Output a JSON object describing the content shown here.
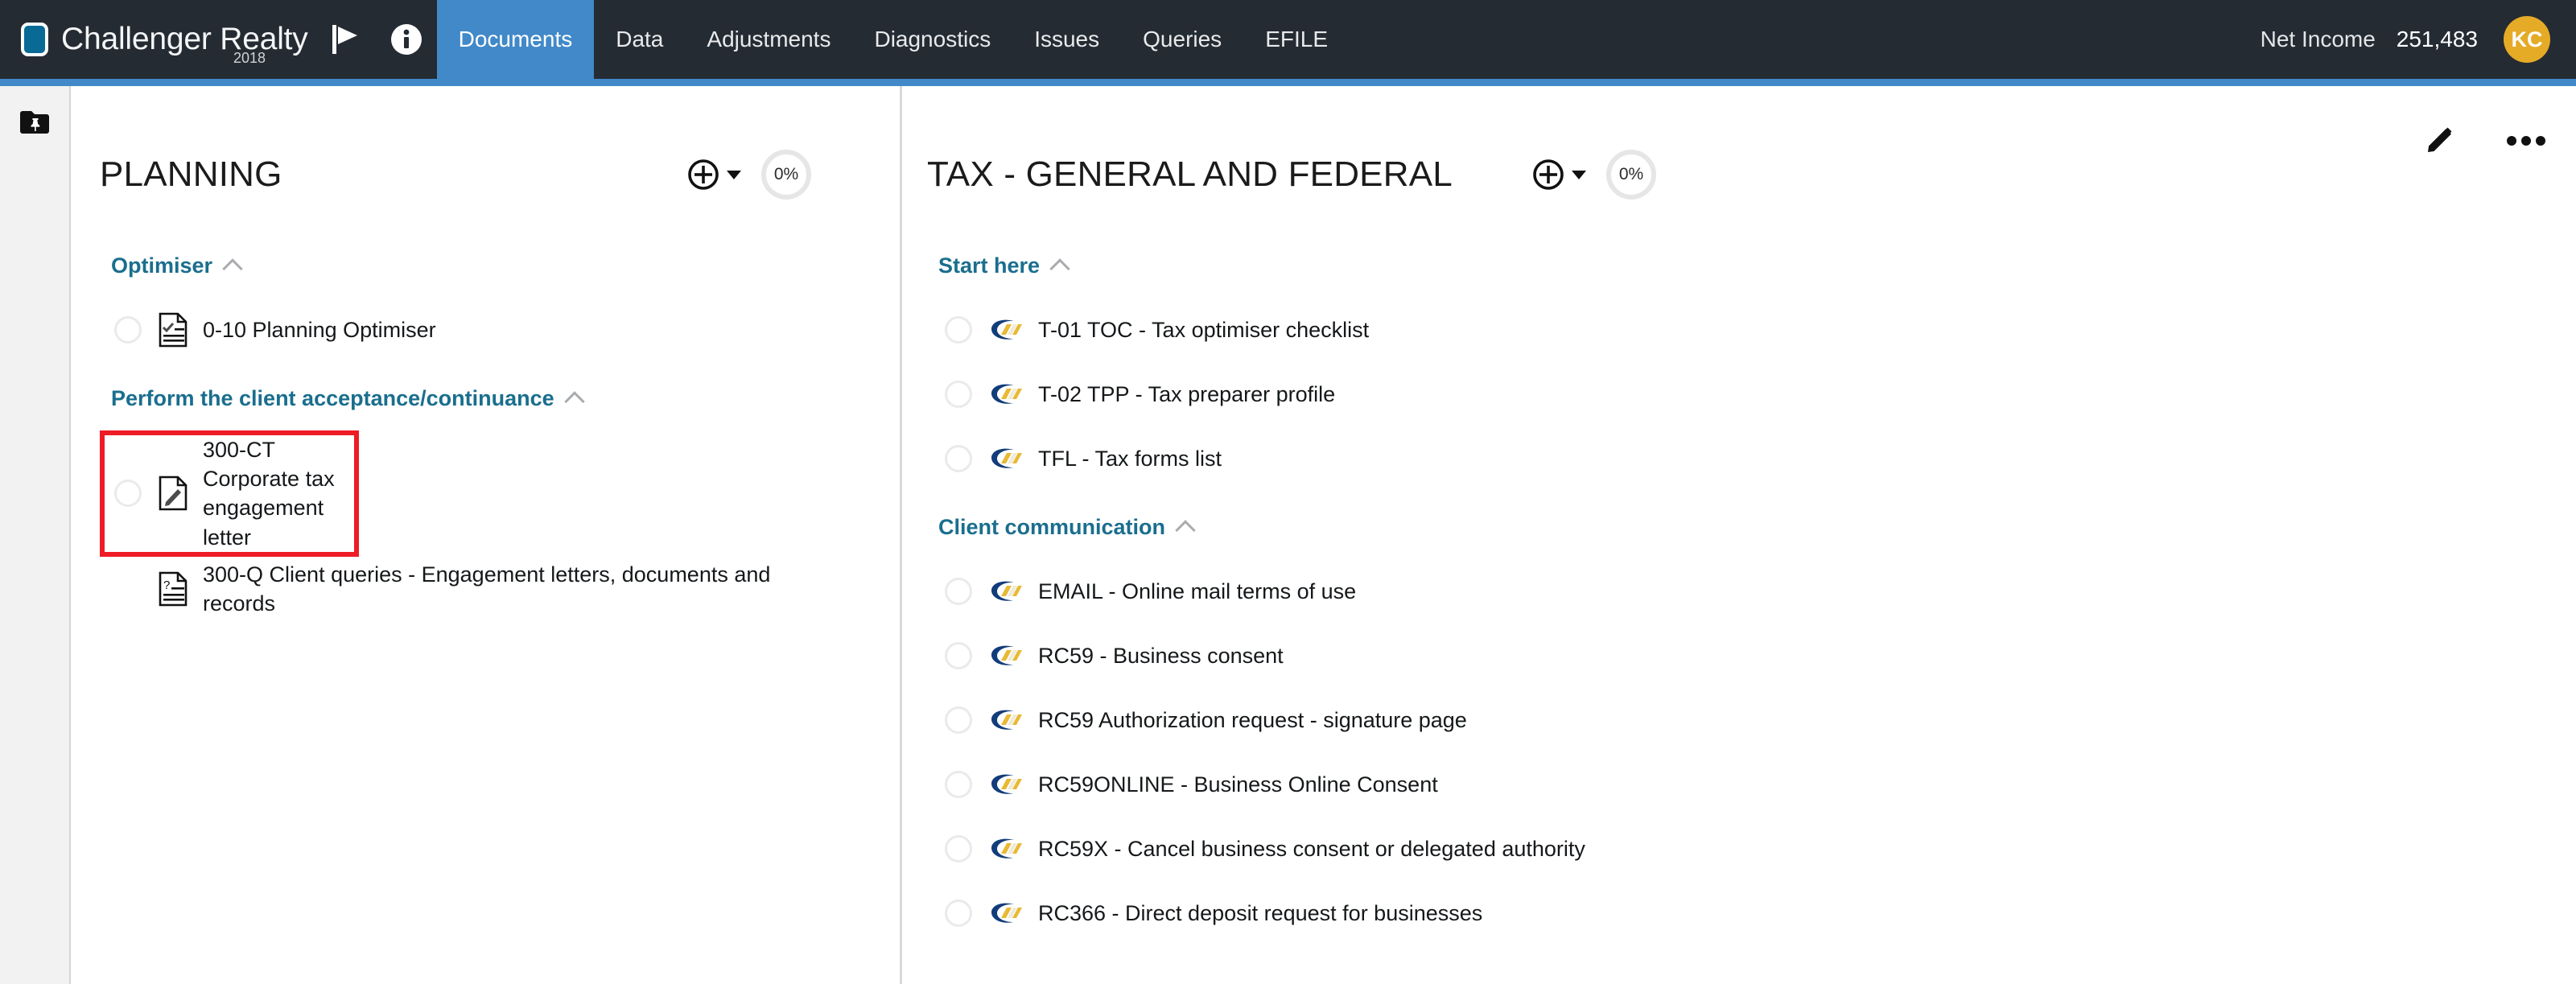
{
  "header": {
    "brand_name": "Challenger Realty",
    "brand_year": "2018",
    "flag_icon": "flag-icon",
    "info_icon": "info-icon",
    "tabs": [
      {
        "label": "Documents",
        "active": true
      },
      {
        "label": "Data",
        "active": false
      },
      {
        "label": "Adjustments",
        "active": false
      },
      {
        "label": "Diagnostics",
        "active": false
      },
      {
        "label": "Issues",
        "active": false
      },
      {
        "label": "Queries",
        "active": false
      },
      {
        "label": "EFILE",
        "active": false
      }
    ],
    "net_income_label": "Net Income",
    "net_income_value": "251,483",
    "avatar_initials": "KC",
    "accent_color": "#4189c8",
    "bar_color": "#252b33",
    "avatar_color": "#e5ab27"
  },
  "left_rail": {
    "pin_folder_icon": "folder-pin-icon"
  },
  "page_actions": {
    "edit_icon": "pencil-icon",
    "more_icon": "ellipsis-icon"
  },
  "columns": [
    {
      "title": "PLANNING",
      "add_label": "add-document",
      "progress": "0%",
      "groups": [
        {
          "title": "Optimiser",
          "items": [
            {
              "label": "0-10 Planning Optimiser",
              "icon": "document-checklist-icon",
              "has_checkbox": true,
              "highlighted": false
            }
          ]
        },
        {
          "title": "Perform the client acceptance/continuance",
          "items": [
            {
              "label": "300-CT Corporate tax engagement letter",
              "icon": "document-pencil-icon",
              "has_checkbox": true,
              "highlighted": true
            },
            {
              "label": "300-Q Client queries - Engagement letters, documents and records",
              "icon": "document-question-icon",
              "has_checkbox": false,
              "highlighted": false
            }
          ]
        }
      ]
    },
    {
      "title": "TAX - GENERAL AND FEDERAL",
      "add_label": "add-document",
      "progress": "0%",
      "groups": [
        {
          "title": "Start here",
          "items": [
            {
              "label": "T-01 TOC - Tax optimiser checklist",
              "icon": "tax-form-icon",
              "has_checkbox": true,
              "highlighted": false
            },
            {
              "label": "T-02 TPP - Tax preparer profile",
              "icon": "tax-form-icon",
              "has_checkbox": true,
              "highlighted": false
            },
            {
              "label": "TFL - Tax forms list",
              "icon": "tax-form-icon",
              "has_checkbox": true,
              "highlighted": false
            }
          ]
        },
        {
          "title": "Client communication",
          "items": [
            {
              "label": "EMAIL - Online mail terms of use",
              "icon": "tax-form-icon",
              "has_checkbox": true,
              "highlighted": false
            },
            {
              "label": "RC59 - Business consent",
              "icon": "tax-form-icon",
              "has_checkbox": true,
              "highlighted": false
            },
            {
              "label": "RC59 Authorization request - signature page",
              "icon": "tax-form-icon",
              "has_checkbox": true,
              "highlighted": false
            },
            {
              "label": "RC59ONLINE - Business Online Consent",
              "icon": "tax-form-icon",
              "has_checkbox": true,
              "highlighted": false
            },
            {
              "label": "RC59X - Cancel business consent or delegated authority",
              "icon": "tax-form-icon",
              "has_checkbox": true,
              "highlighted": false
            },
            {
              "label": "RC366 - Direct deposit request for businesses",
              "icon": "tax-form-icon",
              "has_checkbox": true,
              "highlighted": false
            }
          ]
        }
      ]
    }
  ],
  "highlight_color": "#ee1c25"
}
